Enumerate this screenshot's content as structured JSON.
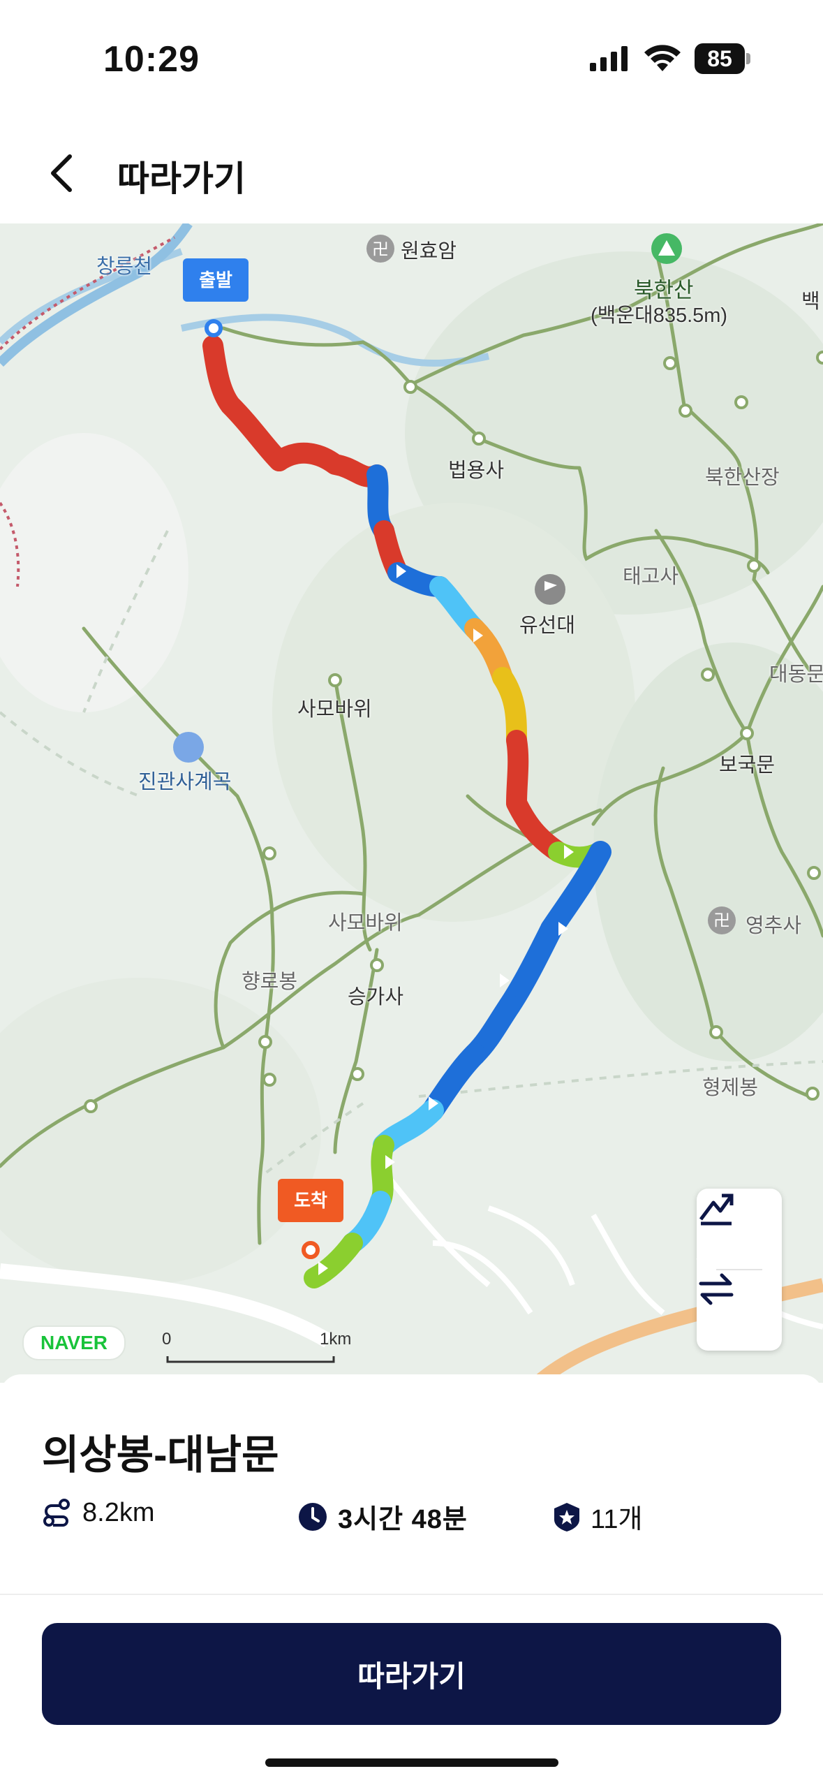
{
  "status_bar": {
    "time": "10:29",
    "battery": "85"
  },
  "header": {
    "title": "따라가기"
  },
  "map": {
    "start_label": "출발",
    "end_label": "도착",
    "places": {
      "wonhyoam": "원효암",
      "bukhansan": "북한산",
      "baegundae": "(백운대835.5m)",
      "baek": "백",
      "changneungcheon": "창릉천",
      "beopyongsa": "법용사",
      "bukhansanjang": "북한산장",
      "taegosa": "태고사",
      "yuseondae": "유선대",
      "daedongmun": "대동문",
      "samobawi1": "사모바위",
      "jingwansa": "진관사계곡",
      "bogukmun": "보국문",
      "samobawi2": "사모바위",
      "yeongchusa": "영추사",
      "hyangrobong": "향로봉",
      "seunggasa": "승가사",
      "hyeongjebong": "형제봉"
    },
    "provider": "NAVER",
    "scale_start": "0",
    "scale_end": "1km"
  },
  "route": {
    "name": "의상봉-대남문",
    "distance": "8.2km",
    "duration": "3시간 48분",
    "badge_count": "11개"
  },
  "actions": {
    "follow": "따라가기"
  },
  "colors": {
    "primary_button": "#0d1646",
    "start_pin": "#2f80ed",
    "end_pin": "#f05a23",
    "trail_green": "#8aa86b",
    "route_red": "#d93a2b",
    "route_blue": "#1e6fd9",
    "route_green": "#8bcf2f"
  }
}
